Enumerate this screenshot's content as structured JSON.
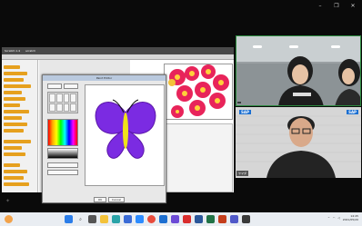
{
  "window": {
    "controls": [
      "–",
      "❐",
      "✕"
    ]
  },
  "share": {
    "app_title": "Scratch 1.4",
    "project_title": "scratch",
    "paint_editor_title": "Paint Editor",
    "buttons": {
      "ok": "OK",
      "cancel": "Cancel"
    }
  },
  "tiles": [
    {
      "name": ""
    },
    {
      "name": "ヤマダ"
    }
  ],
  "taskbar": {
    "icons": [
      "windows",
      "search",
      "task-view",
      "files",
      "edge",
      "store",
      "zoom",
      "chrome",
      "mail",
      "calendar",
      "word",
      "excel",
      "powerpoint",
      "teams",
      "settings",
      "camera"
    ],
    "time": "14:45",
    "date": "2021/05/20"
  },
  "colors": {
    "tile_active": "#2b8a3e",
    "scratch_block": "#e6a01e",
    "butterfly": "#7b2be2",
    "sap": "#1b6fd1"
  }
}
